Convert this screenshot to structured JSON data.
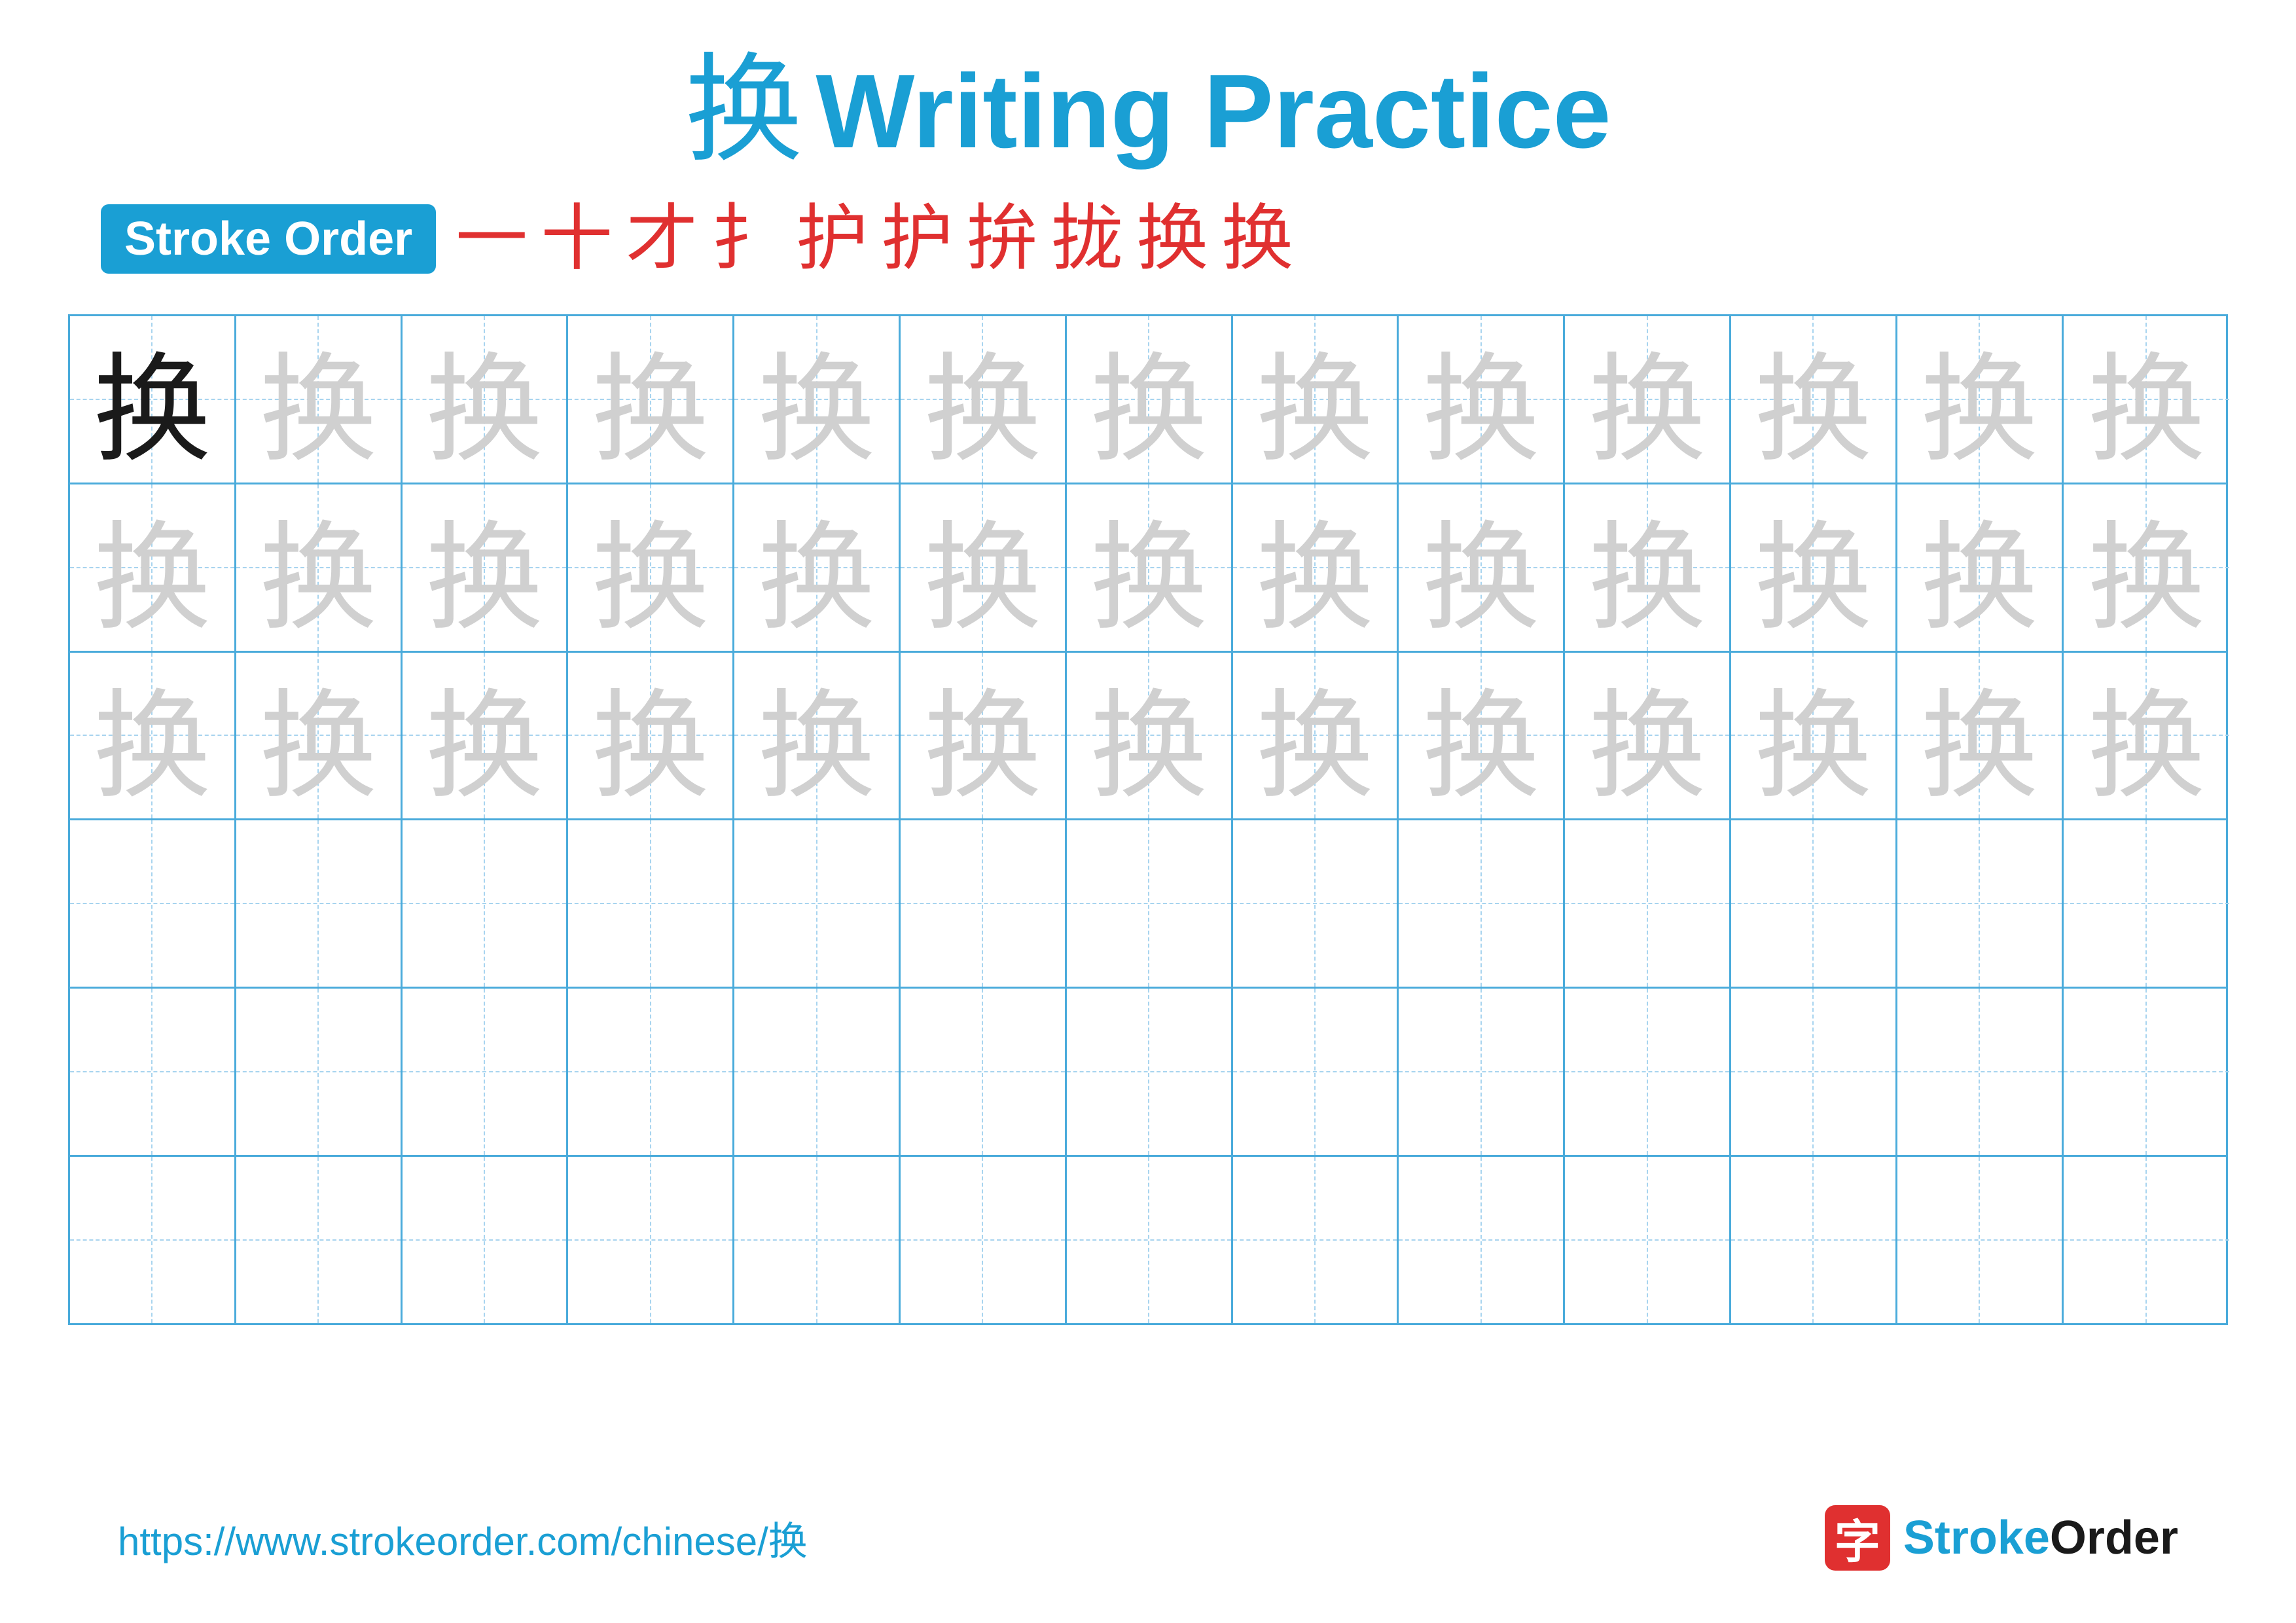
{
  "title": {
    "char": "换",
    "text": "Writing Practice"
  },
  "stroke_order": {
    "badge_label": "Stroke Order",
    "strokes": [
      "一",
      "十",
      "才",
      "扌",
      "护",
      "护",
      "拚",
      "拢",
      "换",
      "换"
    ]
  },
  "grid": {
    "rows": 6,
    "cols": 13,
    "char": "换",
    "dark_cells": [
      [
        0,
        0
      ]
    ],
    "light_rows": [
      0,
      1,
      2
    ]
  },
  "footer": {
    "url": "https://www.strokeorder.com/chinese/换",
    "logo_char": "字",
    "logo_name_part1": "Stroke",
    "logo_name_part2": "Order"
  }
}
